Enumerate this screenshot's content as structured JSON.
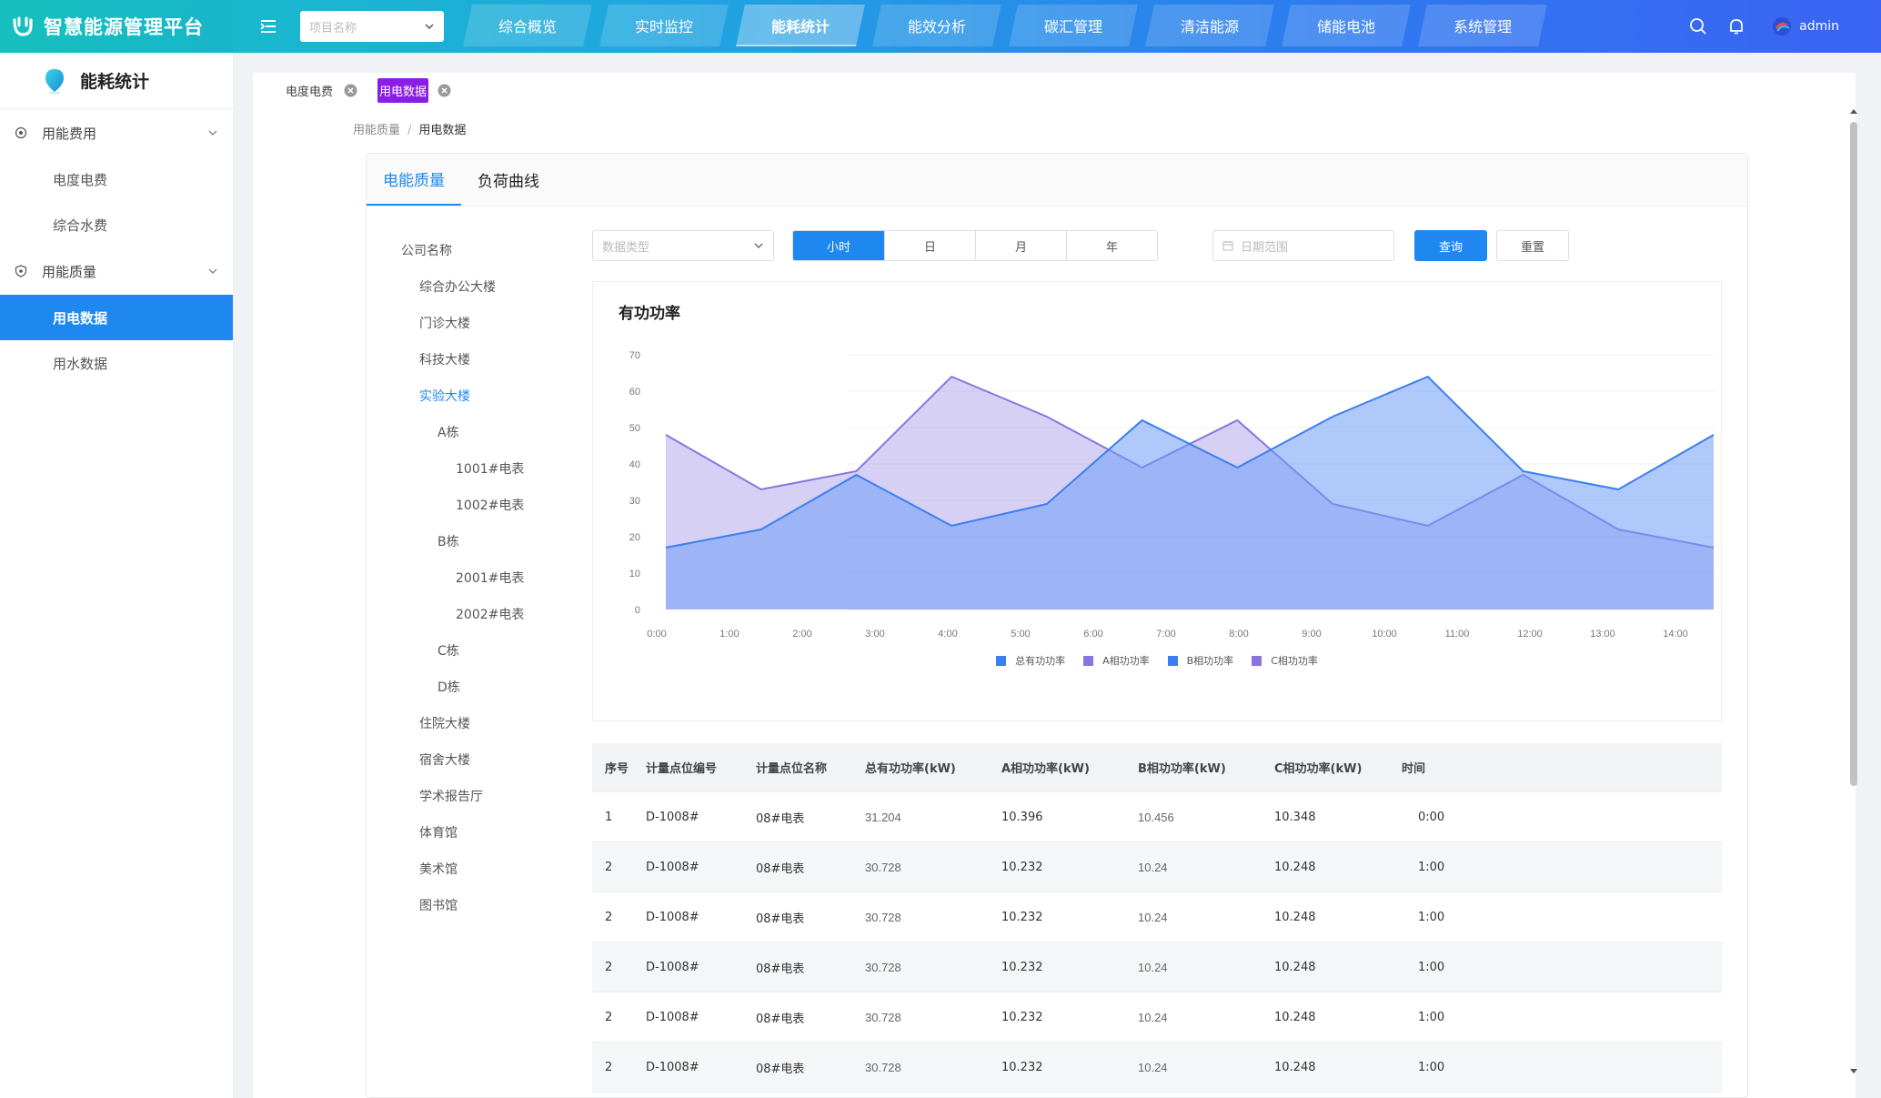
{
  "app": {
    "title": "智慧能源管理平台"
  },
  "header": {
    "project_placeholder": "项目名称",
    "nav": [
      {
        "label": "综合概览"
      },
      {
        "label": "实时监控"
      },
      {
        "label": "能耗统计"
      },
      {
        "label": "能效分析"
      },
      {
        "label": "碳汇管理"
      },
      {
        "label": "清洁能源"
      },
      {
        "label": "储能电池"
      },
      {
        "label": "系统管理"
      }
    ],
    "active_nav": "能耗统计",
    "user": "admin"
  },
  "sidebar": {
    "title": "能耗统计",
    "groups": [
      {
        "label": "用能费用",
        "items": [
          {
            "label": "电度电费"
          },
          {
            "label": "综合水费"
          }
        ]
      },
      {
        "label": "用能质量",
        "items": [
          {
            "label": "用电数据"
          },
          {
            "label": "用水数据"
          }
        ]
      }
    ],
    "active_item": "用电数据"
  },
  "tags": [
    {
      "label": "电度电费"
    },
    {
      "label": "用电数据"
    }
  ],
  "breadcrumb": {
    "parent": "用能质量",
    "current": "用电数据",
    "sep": "/"
  },
  "card_tabs": [
    {
      "label": "电能质量"
    },
    {
      "label": "负荷曲线"
    }
  ],
  "tree": [
    {
      "label": "公司名称"
    },
    {
      "label": "综合办公大楼"
    },
    {
      "label": "门诊大楼"
    },
    {
      "label": "科技大楼"
    },
    {
      "label": "实验大楼"
    },
    {
      "label": "A栋"
    },
    {
      "label": "1001#电表"
    },
    {
      "label": "1002#电表"
    },
    {
      "label": "B栋"
    },
    {
      "label": "2001#电表"
    },
    {
      "label": "2002#电表"
    },
    {
      "label": "C栋"
    },
    {
      "label": "D栋"
    },
    {
      "label": "住院大楼"
    },
    {
      "label": "宿舍大楼"
    },
    {
      "label": "学术报告厅"
    },
    {
      "label": "体育馆"
    },
    {
      "label": "美术馆"
    },
    {
      "label": "图书馆"
    }
  ],
  "filters": {
    "type_placeholder": "数据类型",
    "periods": [
      {
        "label": "小时"
      },
      {
        "label": "日"
      },
      {
        "label": "月"
      },
      {
        "label": "年"
      }
    ],
    "active_period": "小时",
    "date_placeholder": "日期范围",
    "query_label": "查询",
    "reset_label": "重置"
  },
  "chart_data": {
    "type": "area",
    "title": "有功功率",
    "x": [
      "0:00",
      "1:00",
      "2:00",
      "3:00",
      "4:00",
      "5:00",
      "6:00",
      "7:00",
      "8:00",
      "9:00",
      "10:00",
      "11:00",
      "12:00",
      "13:00",
      "14:00"
    ],
    "ylim": [
      0,
      70
    ],
    "yticks": [
      0,
      10,
      20,
      30,
      40,
      50,
      60,
      70
    ],
    "grid": true,
    "legend_position": "bottom",
    "series": [
      {
        "name": "总有功功率",
        "color": "#3b7ff0",
        "values": [
          17,
          22,
          37,
          23,
          29,
          52,
          39,
          53,
          64,
          38,
          33,
          48
        ]
      },
      {
        "name": "A相功功率",
        "color": "#8a75e0",
        "values": [
          48,
          33,
          38,
          64,
          53,
          39,
          52,
          29,
          23,
          37,
          22,
          17
        ]
      },
      {
        "name": "B相功功率",
        "color": "#3b7ff0",
        "values": []
      },
      {
        "name": "C相功功率",
        "color": "#8a75e0",
        "values": []
      }
    ]
  },
  "table": {
    "columns": [
      "序号",
      "计量点位编号",
      "计量点位名称",
      "总有功功率(kW)",
      "A相功功率(kW)",
      "B相功功率(kW)",
      "C相功功率(kW)",
      "时间"
    ],
    "rows": [
      [
        "1",
        "D-1008#",
        "08#电表",
        "31.204",
        "10.396",
        "10.456",
        "10.348",
        "0:00"
      ],
      [
        "2",
        "D-1008#",
        "08#电表",
        "30.728",
        "10.232",
        "10.24",
        "10.248",
        "1:00"
      ],
      [
        "2",
        "D-1008#",
        "08#电表",
        "30.728",
        "10.232",
        "10.24",
        "10.248",
        "1:00"
      ],
      [
        "2",
        "D-1008#",
        "08#电表",
        "30.728",
        "10.232",
        "10.24",
        "10.248",
        "1:00"
      ],
      [
        "2",
        "D-1008#",
        "08#电表",
        "30.728",
        "10.232",
        "10.24",
        "10.248",
        "1:00"
      ],
      [
        "2",
        "D-1008#",
        "08#电表",
        "30.728",
        "10.232",
        "10.24",
        "10.248",
        "1:00"
      ]
    ]
  },
  "colors": {
    "accent": "#1e88f0",
    "tag_active": "#8a1ee6"
  }
}
